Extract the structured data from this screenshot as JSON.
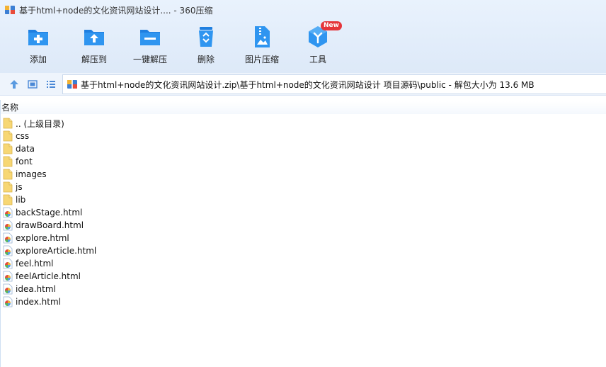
{
  "window": {
    "title": "基于html+node的文化资讯网站设计.... - 360压缩"
  },
  "toolbar": {
    "add_label": "添加",
    "extract_to_label": "解压到",
    "one_click_extract_label": "一键解压",
    "delete_label": "删除",
    "image_compress_label": "图片压缩",
    "tools_label": "工具",
    "tools_badge": "New"
  },
  "address": {
    "path": "基于html+node的文化资讯网站设计.zip\\基于html+node的文化资讯网站设计 项目源码\\public - 解包大小为 13.6 MB"
  },
  "list": {
    "column_name": "名称",
    "items": [
      {
        "name": ".. (上级目录)",
        "type": "folder"
      },
      {
        "name": "css",
        "type": "folder"
      },
      {
        "name": "data",
        "type": "folder"
      },
      {
        "name": "font",
        "type": "folder"
      },
      {
        "name": "images",
        "type": "folder"
      },
      {
        "name": "js",
        "type": "folder"
      },
      {
        "name": "lib",
        "type": "folder"
      },
      {
        "name": "backStage.html",
        "type": "html"
      },
      {
        "name": "drawBoard.html",
        "type": "html"
      },
      {
        "name": "explore.html",
        "type": "html"
      },
      {
        "name": "exploreArticle.html",
        "type": "html"
      },
      {
        "name": "feel.html",
        "type": "html"
      },
      {
        "name": "feelArticle.html",
        "type": "html"
      },
      {
        "name": "idea.html",
        "type": "html"
      },
      {
        "name": "index.html",
        "type": "html"
      }
    ]
  },
  "colors": {
    "icon_blue": "#2f8ee8",
    "folder_yellow": "#f7d774",
    "badge_red": "#e5353b"
  }
}
